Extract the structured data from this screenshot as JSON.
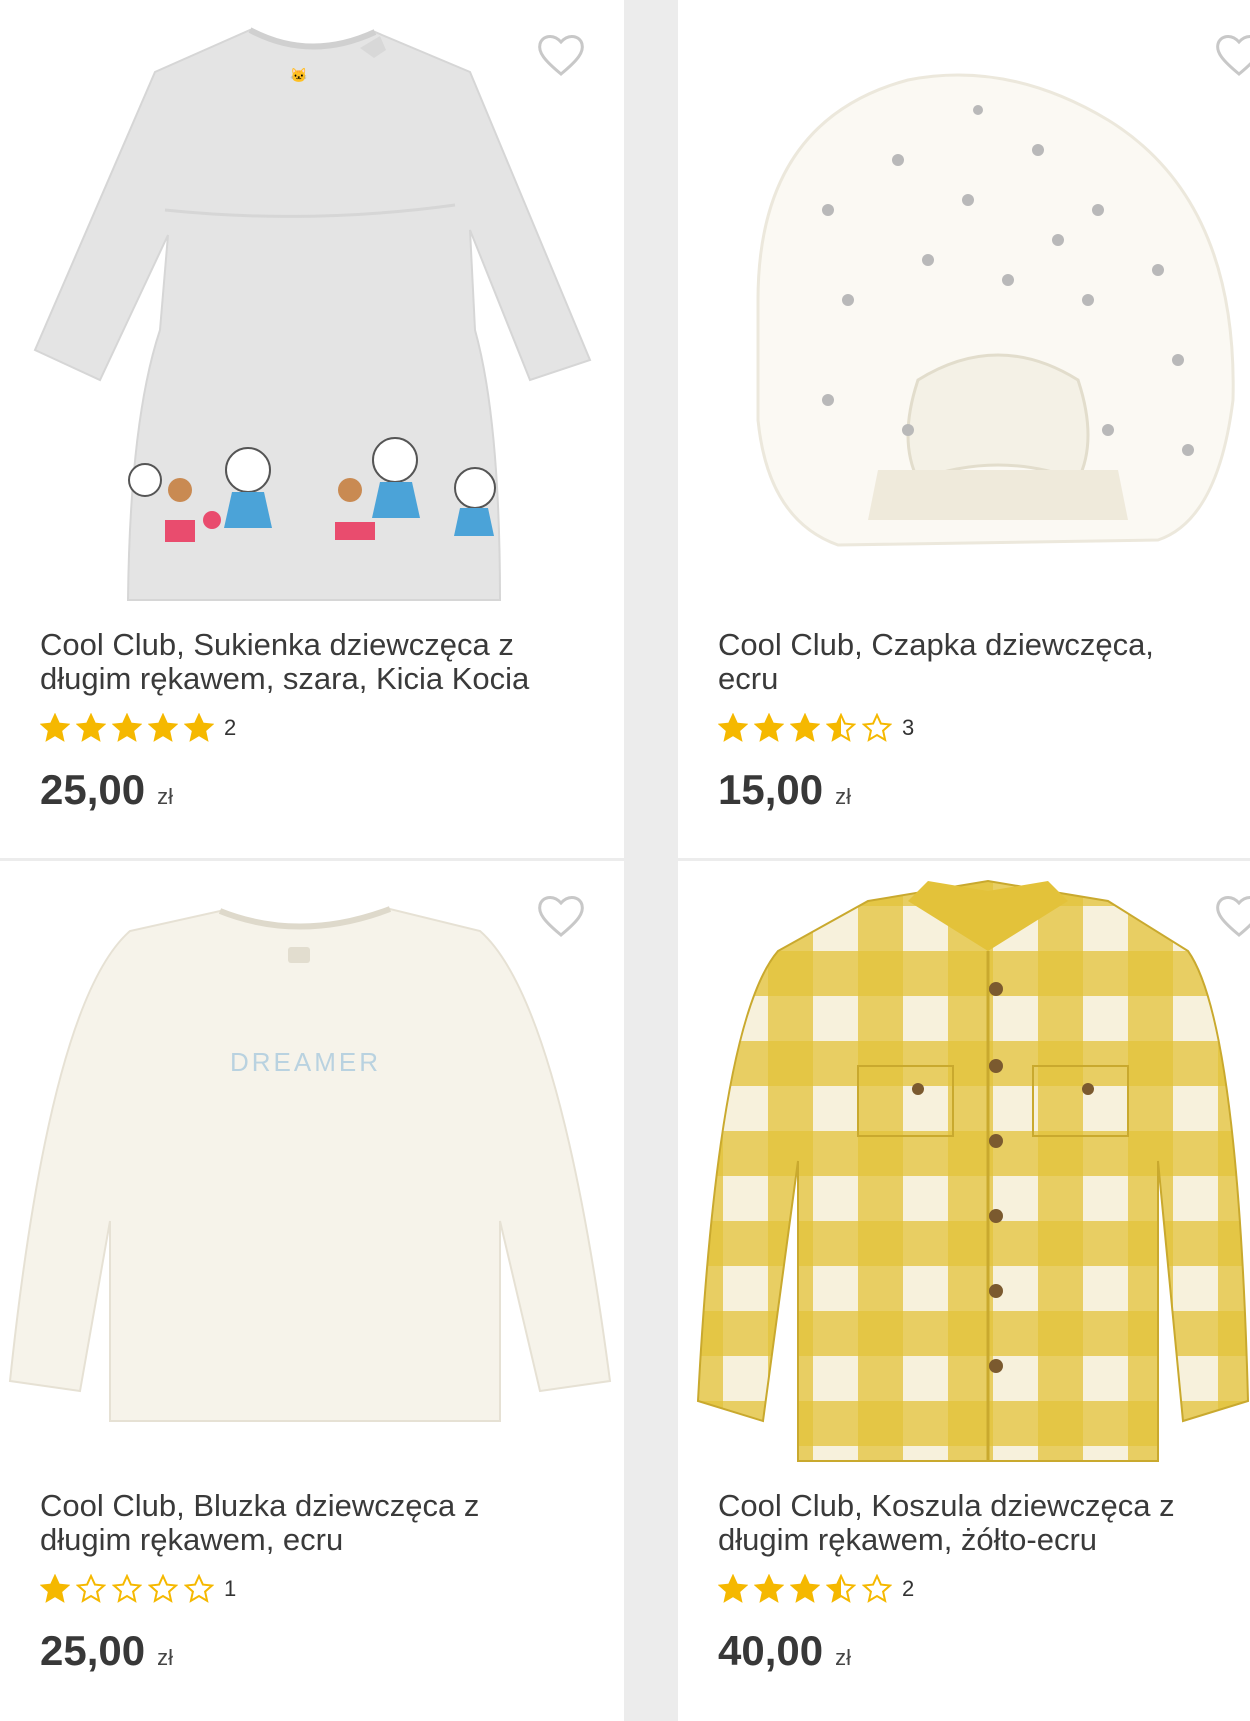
{
  "products": [
    {
      "title_lines": [
        "Cool Club, Sukienka dziewczęca z",
        "długim rękawem, szara, Kicia Kocia"
      ],
      "rating": 5,
      "review_count": "2",
      "price": "25,00",
      "currency": "zł",
      "image": "gray-dress-image"
    },
    {
      "title_lines": [
        "Cool Club, Czapka dziewczęca,",
        "ecru"
      ],
      "rating": 3.5,
      "review_count": "3",
      "price": "15,00",
      "currency": "zł",
      "image": "white-turban-hat-image"
    },
    {
      "title_lines": [
        "Cool Club, Bluzka dziewczęca z",
        "długim rękawem, ecru"
      ],
      "rating": 1,
      "review_count": "1",
      "price": "25,00",
      "currency": "zł",
      "image": "ecru-blouse-image"
    },
    {
      "title_lines": [
        "Cool Club, Koszula dziewczęca z",
        "długim rękawem, żółto-ecru"
      ],
      "rating": 3.5,
      "review_count": "2",
      "price": "40,00",
      "currency": "zł",
      "image": "yellow-check-shirt-image"
    }
  ],
  "colors": {
    "star_filled": "#f5b800",
    "star_empty_stroke": "#f5b800",
    "heart_stroke": "#c8c8c8",
    "page_bg": "#ececec",
    "card_bg": "#ffffff",
    "shirt_yellow": "#e3c23a",
    "shirt_cream": "#f7f1dc"
  }
}
